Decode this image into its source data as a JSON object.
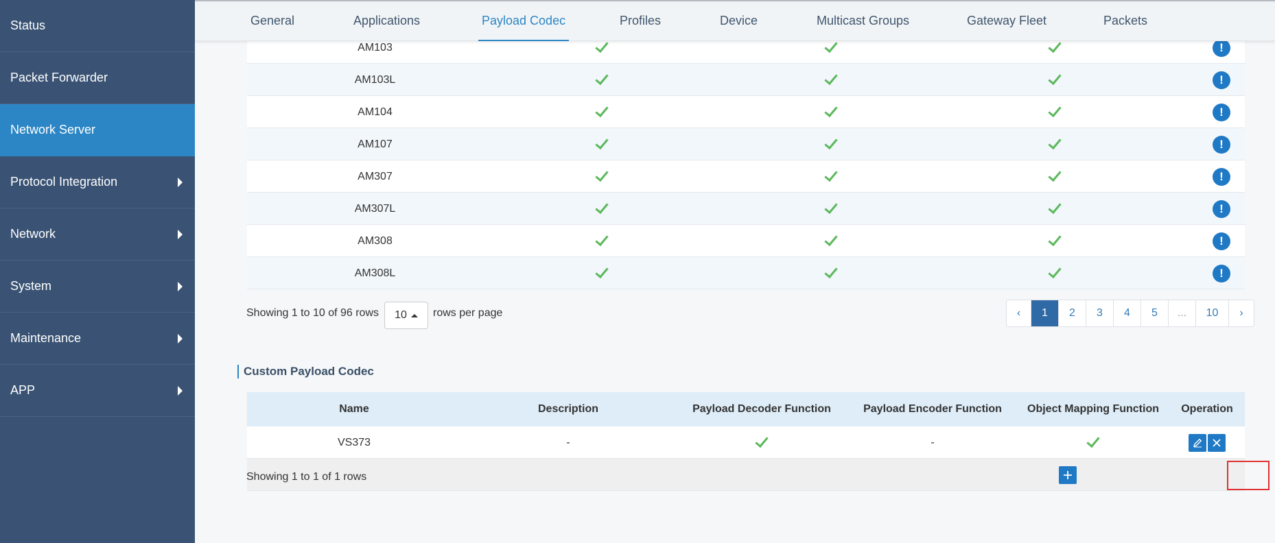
{
  "sidebar": {
    "items": [
      {
        "label": "Status",
        "has_arrow": false
      },
      {
        "label": "Packet Forwarder",
        "has_arrow": false
      },
      {
        "label": "Network Server",
        "has_arrow": false,
        "active": true
      },
      {
        "label": "Protocol Integration",
        "has_arrow": true
      },
      {
        "label": "Network",
        "has_arrow": true
      },
      {
        "label": "System",
        "has_arrow": true
      },
      {
        "label": "Maintenance",
        "has_arrow": true
      },
      {
        "label": "APP",
        "has_arrow": true
      }
    ]
  },
  "tabs": [
    {
      "label": "General"
    },
    {
      "label": "Applications"
    },
    {
      "label": "Payload Codec",
      "active": true
    },
    {
      "label": "Profiles"
    },
    {
      "label": "Device"
    },
    {
      "label": "Multicast Groups"
    },
    {
      "label": "Gateway Fleet"
    },
    {
      "label": "Packets"
    }
  ],
  "codec_table": {
    "rows": [
      {
        "name": "AM103",
        "decoder": true,
        "encoder": true,
        "mapping": true
      },
      {
        "name": "AM103L",
        "decoder": true,
        "encoder": true,
        "mapping": true
      },
      {
        "name": "AM104",
        "decoder": true,
        "encoder": true,
        "mapping": true
      },
      {
        "name": "AM107",
        "decoder": true,
        "encoder": true,
        "mapping": true
      },
      {
        "name": "AM307",
        "decoder": true,
        "encoder": true,
        "mapping": true
      },
      {
        "name": "AM307L",
        "decoder": true,
        "encoder": true,
        "mapping": true
      },
      {
        "name": "AM308",
        "decoder": true,
        "encoder": true,
        "mapping": true
      },
      {
        "name": "AM308L",
        "decoder": true,
        "encoder": true,
        "mapping": true
      }
    ],
    "footer": {
      "showing_text": "Showing 1 to 10 of 96 rows",
      "rows_per_page_value": "10",
      "rows_per_page_text": "rows per page"
    },
    "pagination": [
      "‹",
      "1",
      "2",
      "3",
      "4",
      "5",
      "...",
      "10",
      "›"
    ],
    "current_page": "1"
  },
  "custom_codec": {
    "section_title": "Custom Payload Codec",
    "headers": {
      "name": "Name",
      "description": "Description",
      "decoder": "Payload Decoder Function",
      "encoder": "Payload Encoder Function",
      "mapping": "Object Mapping Function",
      "operation": "Operation"
    },
    "rows": [
      {
        "name": "VS373",
        "description": "-",
        "decoder": true,
        "encoder": "-",
        "mapping": true
      }
    ],
    "footer_text": "Showing 1 to 1 of 1 rows"
  },
  "colors": {
    "sidebar_bg": "#3a5374",
    "sidebar_active": "#2c86c5",
    "accent": "#1f79c5",
    "check": "#5cb85c",
    "highlight": "#e23030"
  }
}
